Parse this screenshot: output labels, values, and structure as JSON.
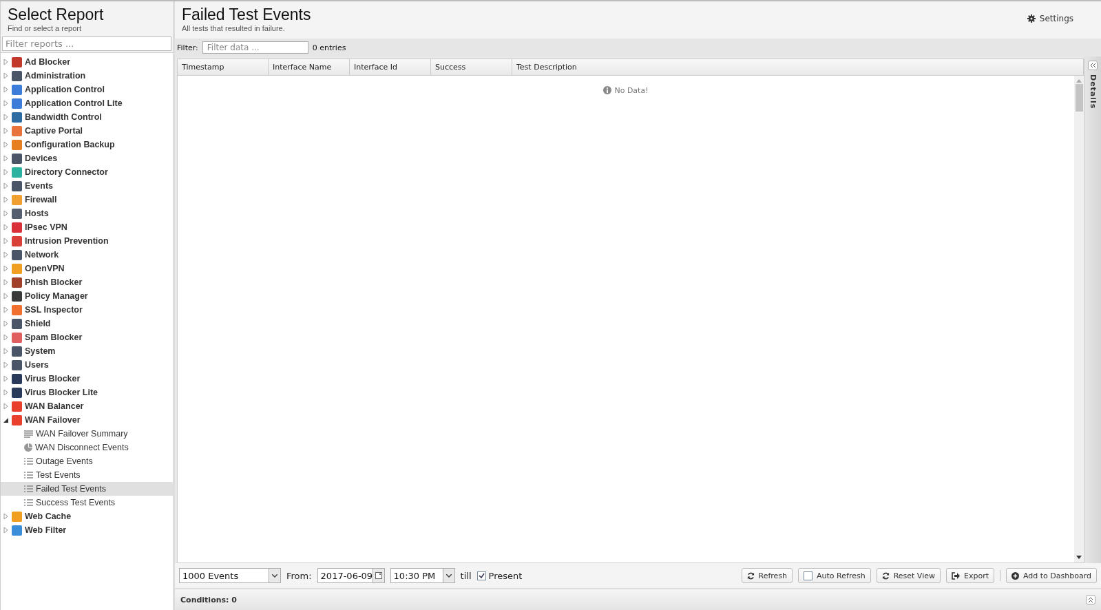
{
  "sidebar": {
    "title": "Select Report",
    "subtitle": "Find or select a report",
    "filter": {
      "placeholder": "Filter reports ..."
    },
    "items": [
      {
        "label": "Ad Blocker",
        "color": "#c0392b",
        "expanded": false,
        "selected": false
      },
      {
        "label": "Administration",
        "color": "#4a5568",
        "expanded": false,
        "selected": false
      },
      {
        "label": "Application Control",
        "color": "#3b7dd8",
        "expanded": false,
        "selected": false
      },
      {
        "label": "Application Control Lite",
        "color": "#3b7dd8",
        "expanded": false,
        "selected": false
      },
      {
        "label": "Bandwidth Control",
        "color": "#2d6ca2",
        "expanded": false,
        "selected": false
      },
      {
        "label": "Captive Portal",
        "color": "#e8743b",
        "expanded": false,
        "selected": false
      },
      {
        "label": "Configuration Backup",
        "color": "#e67e22",
        "expanded": false,
        "selected": false
      },
      {
        "label": "Devices",
        "color": "#4a5568",
        "expanded": false,
        "selected": false
      },
      {
        "label": "Directory Connector",
        "color": "#2bb3a0",
        "expanded": false,
        "selected": false
      },
      {
        "label": "Events",
        "color": "#4a5568",
        "expanded": false,
        "selected": false
      },
      {
        "label": "Firewall",
        "color": "#f0a030",
        "expanded": false,
        "selected": false
      },
      {
        "label": "Hosts",
        "color": "#555e6e",
        "expanded": false,
        "selected": false
      },
      {
        "label": "IPsec VPN",
        "color": "#d9303a",
        "expanded": false,
        "selected": false
      },
      {
        "label": "Intrusion Prevention",
        "color": "#d9403a",
        "expanded": false,
        "selected": false
      },
      {
        "label": "Network",
        "color": "#4a5568",
        "expanded": false,
        "selected": false
      },
      {
        "label": "OpenVPN",
        "color": "#f0a020",
        "expanded": false,
        "selected": false
      },
      {
        "label": "Phish Blocker",
        "color": "#a0402a",
        "expanded": false,
        "selected": false
      },
      {
        "label": "Policy Manager",
        "color": "#3a3a3a",
        "expanded": false,
        "selected": false
      },
      {
        "label": "SSL Inspector",
        "color": "#f07030",
        "expanded": false,
        "selected": false
      },
      {
        "label": "Shield",
        "color": "#4a5568",
        "expanded": false,
        "selected": false
      },
      {
        "label": "Spam Blocker",
        "color": "#e06060",
        "expanded": false,
        "selected": false
      },
      {
        "label": "System",
        "color": "#4a5568",
        "expanded": false,
        "selected": false
      },
      {
        "label": "Users",
        "color": "#4a5568",
        "expanded": false,
        "selected": false
      },
      {
        "label": "Virus Blocker",
        "color": "#2a3a5a",
        "expanded": false,
        "selected": false
      },
      {
        "label": "Virus Blocker Lite",
        "color": "#2a3a5a",
        "expanded": false,
        "selected": false
      },
      {
        "label": "WAN Balancer",
        "color": "#e8402a",
        "expanded": false,
        "selected": false
      },
      {
        "label": "WAN Failover",
        "color": "#e8402a",
        "expanded": true,
        "selected": false,
        "children": [
          {
            "label": "WAN Failover Summary",
            "kind": "text",
            "selected": false
          },
          {
            "label": "WAN Disconnect Events",
            "kind": "pie",
            "selected": false
          },
          {
            "label": "Outage Events",
            "kind": "list",
            "selected": false
          },
          {
            "label": "Test Events",
            "kind": "list",
            "selected": false
          },
          {
            "label": "Failed Test Events",
            "kind": "list",
            "selected": true
          },
          {
            "label": "Success Test Events",
            "kind": "list",
            "selected": false
          }
        ]
      },
      {
        "label": "Web Cache",
        "color": "#f0a020",
        "expanded": false,
        "selected": false
      },
      {
        "label": "Web Filter",
        "color": "#3b8fd8",
        "expanded": false,
        "selected": false
      }
    ]
  },
  "report": {
    "title": "Failed Test Events",
    "subtitle": "All tests that resulted in failure.",
    "settings": "Settings",
    "filter": {
      "label": "Filter:",
      "placeholder": "Filter data ...",
      "count": "0 entries"
    },
    "table": {
      "columns": [
        "Timestamp",
        "Interface Name",
        "Interface Id",
        "Success",
        "Test Description"
      ],
      "empty": "No Data!"
    },
    "details": "Details",
    "toolbar": {
      "limit": "1000 Events",
      "from_label": "From:",
      "date": "2017-06-09",
      "time": "10:30 PM",
      "till": "till",
      "present": {
        "label": "Present",
        "checked": true
      },
      "buttons": [
        {
          "label": "Refresh",
          "kind": "refresh"
        },
        {
          "label": "Auto Refresh",
          "kind": "checkbox",
          "checked": false
        },
        {
          "label": "Reset View",
          "kind": "refresh"
        },
        {
          "label": "Export",
          "kind": "export"
        },
        {
          "label": "Add to Dashboard",
          "kind": "add"
        }
      ]
    },
    "conditions": "Conditions: 0"
  }
}
